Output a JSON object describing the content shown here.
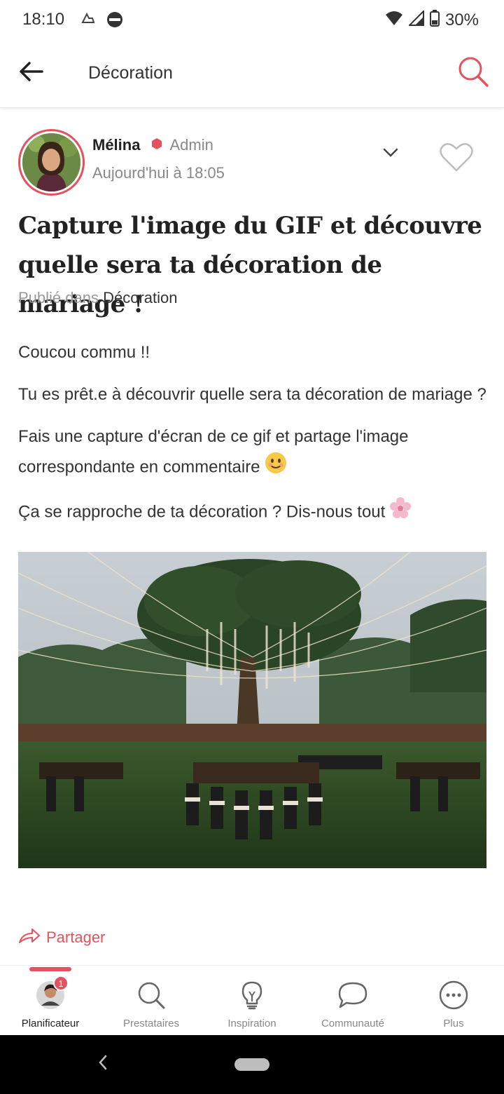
{
  "status_bar": {
    "time": "18:10",
    "battery": "30%",
    "icons": [
      "cloud-icon",
      "circle-icon",
      "wifi-icon",
      "signal-icon",
      "battery-icon"
    ]
  },
  "app_bar": {
    "title": "Décoration",
    "back_icon": "arrow-left-icon",
    "search_icon": "search-icon",
    "accent_color": "#e5525f"
  },
  "post": {
    "author": "Mélina",
    "role": "Admin",
    "date": "Aujourd'hui à 18:05",
    "title": "Capture l'image du GIF et découvre quelle sera ta décoration de mariage !",
    "published_prefix": "Publié dans",
    "published_category": "Décoration",
    "paragraphs": [
      "Coucou commu !!",
      "Tu es prêt.e à découvrir quelle sera ta décoration de mariage ?",
      "Fais une capture d'écran de ce gif et partage l'image correspondante en commentaire",
      "Ça se rapproche de ta décoration ? Dis-nous tout"
    ],
    "share_label": "Partager"
  },
  "bottom_nav": {
    "items": [
      {
        "label": "Planificateur",
        "icon": "profile-avatar-icon",
        "badge": "1",
        "active": true
      },
      {
        "label": "Prestataires",
        "icon": "search-icon"
      },
      {
        "label": "Inspiration",
        "icon": "lightbulb-icon"
      },
      {
        "label": "Communauté",
        "icon": "chat-bubble-icon"
      },
      {
        "label": "Plus",
        "icon": "more-icon"
      }
    ]
  }
}
